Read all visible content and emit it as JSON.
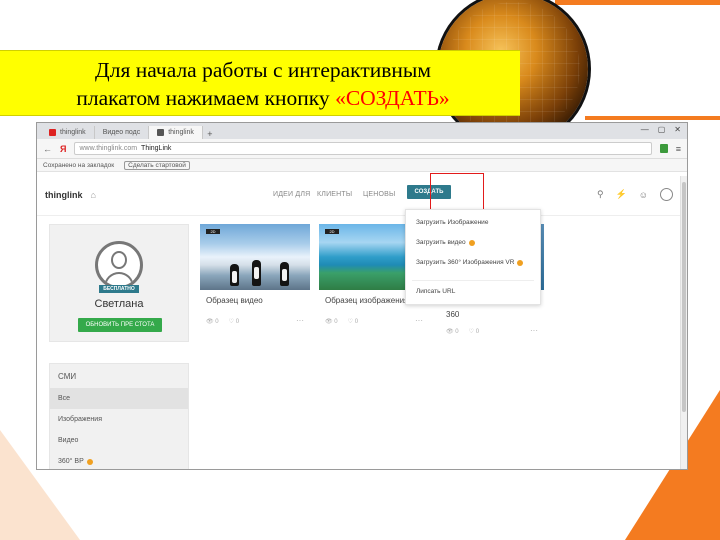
{
  "slide": {
    "title_line1": "Для начала работы с интерактивным",
    "title_line2_plain": "плакатом нажимаем кнопку ",
    "title_line2_accent": "«СОЗДАТЬ»",
    "accent_color": "#f47b20",
    "highlight_color": "#ffff00"
  },
  "browser": {
    "tabs": [
      {
        "label": "thinglink",
        "icon": "yandex-favicon"
      },
      {
        "label": "Видео подс",
        "icon": "page-favicon"
      },
      {
        "label": "thinglink",
        "icon": "thinglink-favicon"
      }
    ],
    "new_tab": "+",
    "window_controls": [
      "—",
      "▢",
      "✕"
    ],
    "address": {
      "back": "←",
      "yandex": "Я",
      "url_prefix": "www.thinglink.com",
      "url_title": "ThingLink",
      "menu": "≡"
    },
    "bookmarks": [
      "Сохранено на закладок",
      "Сделать стартовой"
    ]
  },
  "site": {
    "logo": "thinglink",
    "logo_glyph": "⌂",
    "nav_links": [
      "ИДЕИ ДЛЯ",
      "КЛИЕНТЫ",
      "ЦЕНОВЫ"
    ],
    "create_label": "СОЗДАТЬ",
    "nav_icons": [
      "search-icon",
      "bolt-icon",
      "help-icon",
      "avatar-icon"
    ],
    "search_glyph": "⚲",
    "bolt_glyph": "⚡",
    "help_glyph": "☺"
  },
  "profile": {
    "free_badge": "БЕСПЛАТНО",
    "name": "Светлана",
    "upgrade_label": "ОБНОВИТЬ ПРЕ СТОТА"
  },
  "media": {
    "title": "СМИ",
    "items": [
      "Все",
      "Изображения",
      "Видео",
      "360° ВР"
    ]
  },
  "cards": [
    {
      "title": "Образец видео",
      "badge": "2D",
      "views": "0",
      "likes": "0"
    },
    {
      "title": "Образец изображения",
      "badge": "2D",
      "views": "0",
      "likes": "0"
    },
    {
      "title": "360",
      "badge": "",
      "views": "0",
      "likes": "0"
    }
  ],
  "dropdown": {
    "items": [
      "Загрузить Изображение",
      "Загрузить видео",
      "Загрузить 360° Изображения VR",
      "Липсать URL"
    ]
  }
}
